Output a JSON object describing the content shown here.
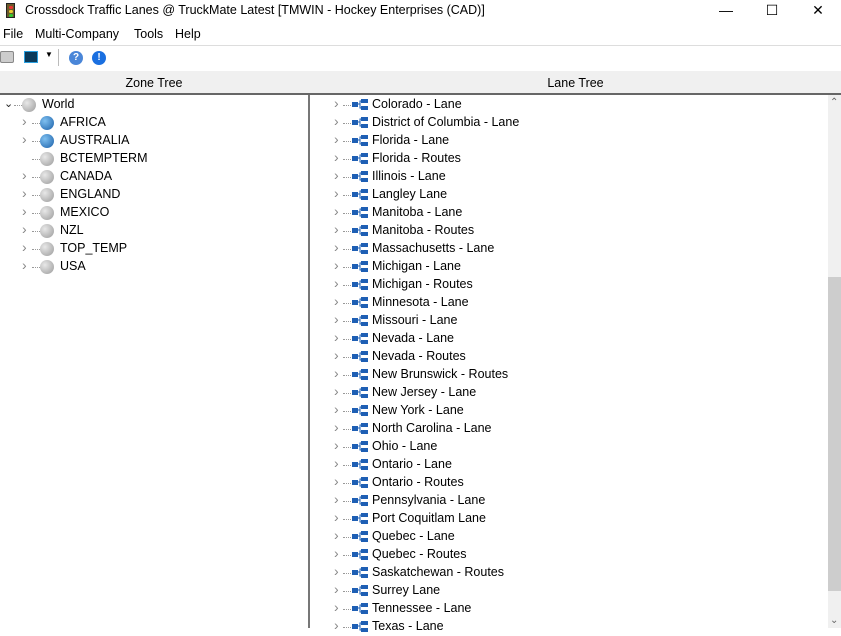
{
  "window": {
    "title": "Crossdock Traffic Lanes @ TruckMate Latest [TMWIN - Hockey Enterprises (CAD)]",
    "minimize": "—",
    "maximize": "☐",
    "close": "✕"
  },
  "menu": [
    "File",
    "Multi-Company",
    "Tools",
    "Help"
  ],
  "toolbar": {
    "icons": [
      "printer-icon",
      "monitor-icon",
      "dropdown-icon",
      "help-icon",
      "info-icon"
    ]
  },
  "zone_tree": {
    "header": "Zone Tree",
    "items": [
      {
        "label": "World",
        "expanded": true,
        "icon": "gray"
      },
      {
        "label": "AFRICA",
        "icon": "blue"
      },
      {
        "label": "AUSTRALIA",
        "icon": "blue"
      },
      {
        "label": "BCTEMPTERM",
        "icon": "gray",
        "leaf": true
      },
      {
        "label": "CANADA",
        "icon": "gray"
      },
      {
        "label": "ENGLAND",
        "icon": "gray"
      },
      {
        "label": "MEXICO",
        "icon": "gray"
      },
      {
        "label": "NZL",
        "icon": "gray"
      },
      {
        "label": "TOP_TEMP",
        "icon": "gray"
      },
      {
        "label": "USA",
        "icon": "gray"
      }
    ]
  },
  "lane_tree": {
    "header": "Lane Tree",
    "items": [
      "Colorado - Lane",
      "District of Columbia - Lane",
      "Florida - Lane",
      "Florida - Routes",
      "Illinois - Lane",
      "Langley Lane",
      "Manitoba - Lane",
      "Manitoba - Routes",
      "Massachusetts - Lane",
      "Michigan - Lane",
      "Michigan - Routes",
      "Minnesota - Lane",
      "Missouri - Lane",
      "Nevada - Lane",
      "Nevada - Routes",
      "New Brunswick - Routes",
      "New Jersey - Lane",
      "New York - Lane",
      "North Carolina - Lane",
      "Ohio - Lane",
      "Ontario - Lane",
      "Ontario - Routes",
      "Pennsylvania - Lane",
      "Port Coquitlam Lane",
      "Quebec - Lane",
      "Quebec - Routes",
      "Saskatchewan - Routes",
      "Surrey Lane",
      "Tennessee - Lane",
      "Texas - Lane"
    ]
  },
  "scrollbar": {
    "position_fraction": 0.33,
    "visible_fraction": 0.63
  }
}
